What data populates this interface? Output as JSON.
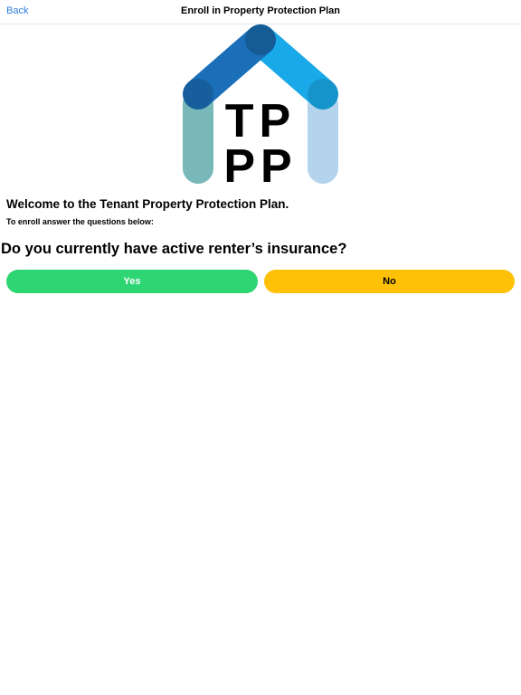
{
  "navbar": {
    "back_label": "Back",
    "title": "Enroll in Property Protection Plan"
  },
  "logo": {
    "line1": "TP",
    "line2": "PP",
    "colors": {
      "roof_dark": "#1a6fb8",
      "roof_light": "#19a8e8",
      "left_pillar": "#78b8b8",
      "right_pillar": "#b4d4ee"
    }
  },
  "main": {
    "welcome": "Welcome to the Tenant Property Protection Plan.",
    "instructions": "To enroll answer the questions below:",
    "question": "Do you currently have active renter’s insurance?"
  },
  "answers": {
    "yes_label": "Yes",
    "no_label": "No",
    "yes_color": "#2ed573",
    "no_color": "#ffc107"
  },
  "theme": {
    "link_color": "#2f7ee6"
  }
}
